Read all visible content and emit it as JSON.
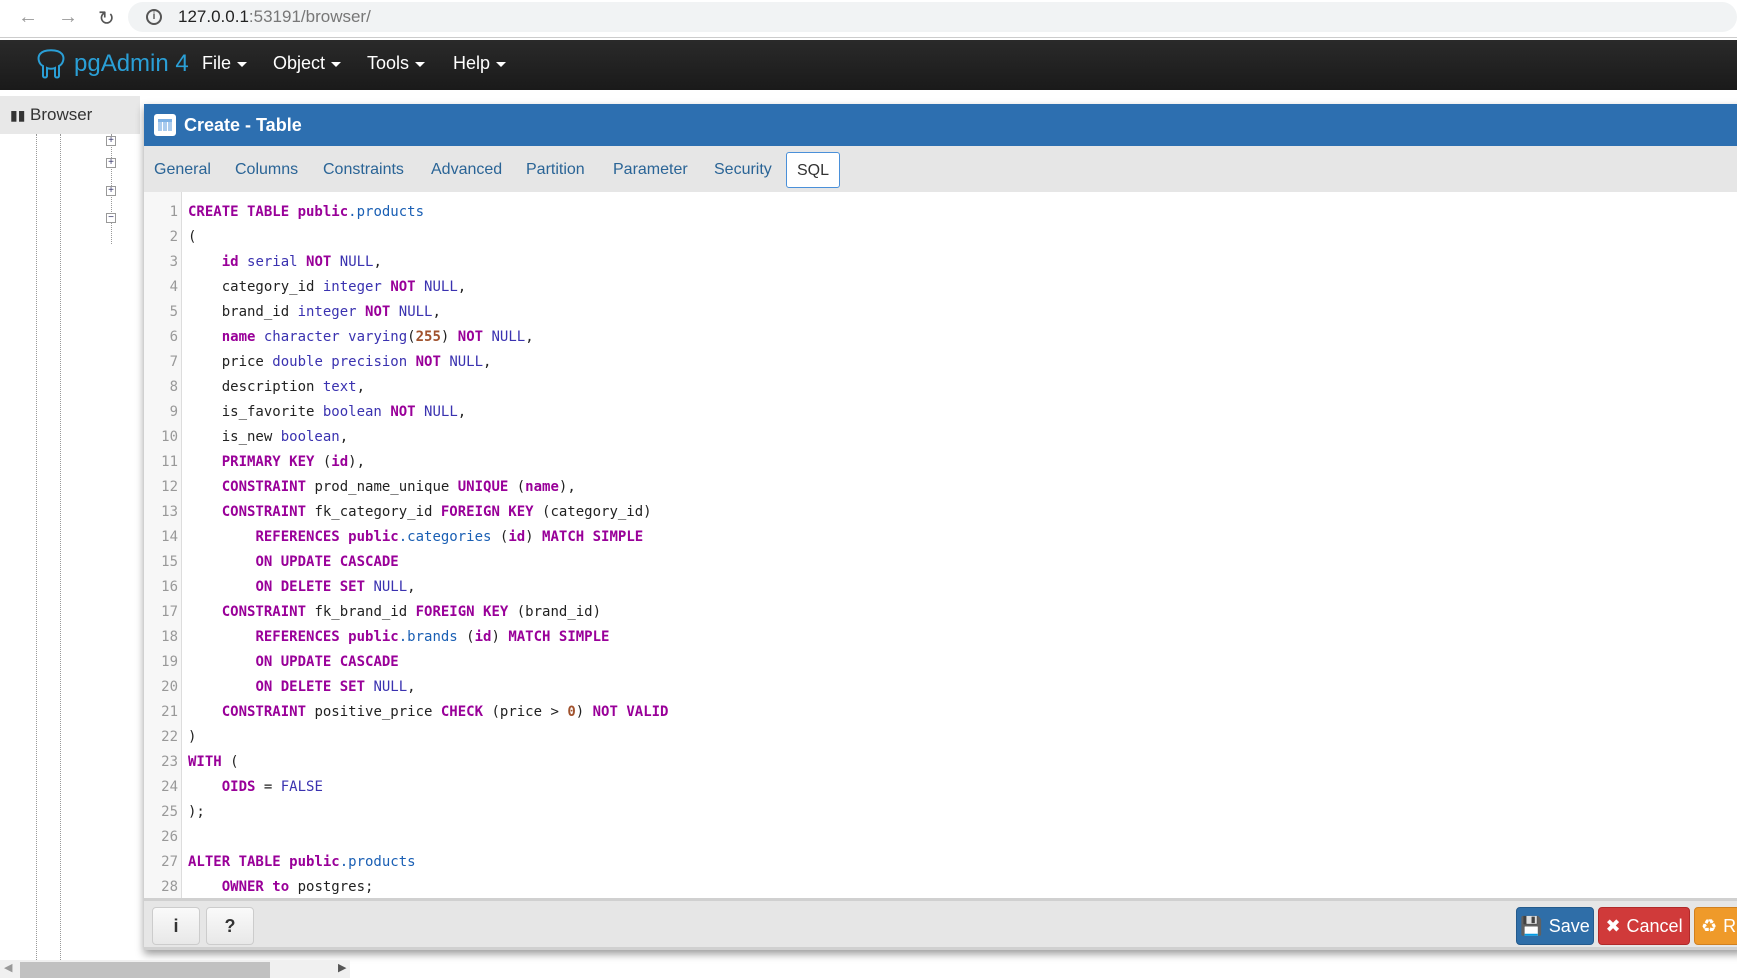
{
  "browser": {
    "url_host": "127.0.0.1",
    "url_rest": ":53191/browser/"
  },
  "app": {
    "brand": "pgAdmin 4",
    "menus": [
      "File",
      "Object",
      "Tools",
      "Help"
    ]
  },
  "panel": {
    "browser_tab": "Browser"
  },
  "dialog": {
    "title": "Create - Table",
    "tabs": [
      "General",
      "Columns",
      "Constraints",
      "Advanced",
      "Partition",
      "Parameter",
      "Security",
      "SQL"
    ],
    "active_tab": "SQL",
    "sql_lines": [
      [
        [
          "k",
          "CREATE TABLE public"
        ],
        [
          "v",
          ".products"
        ]
      ],
      [
        [
          "p",
          "("
        ]
      ],
      [
        [
          "p",
          "    "
        ],
        [
          "k",
          "id"
        ],
        [
          "p",
          " "
        ],
        [
          "t",
          "serial"
        ],
        [
          "p",
          " "
        ],
        [
          "k",
          "NOT"
        ],
        [
          "p",
          " "
        ],
        [
          "t",
          "NULL"
        ],
        [
          "p",
          ","
        ]
      ],
      [
        [
          "p",
          "    category_id "
        ],
        [
          "t",
          "integer"
        ],
        [
          "p",
          " "
        ],
        [
          "k",
          "NOT"
        ],
        [
          "p",
          " "
        ],
        [
          "t",
          "NULL"
        ],
        [
          "p",
          ","
        ]
      ],
      [
        [
          "p",
          "    brand_id "
        ],
        [
          "t",
          "integer"
        ],
        [
          "p",
          " "
        ],
        [
          "k",
          "NOT"
        ],
        [
          "p",
          " "
        ],
        [
          "t",
          "NULL"
        ],
        [
          "p",
          ","
        ]
      ],
      [
        [
          "p",
          "    "
        ],
        [
          "k",
          "name"
        ],
        [
          "p",
          " "
        ],
        [
          "t",
          "character varying"
        ],
        [
          "p",
          "("
        ],
        [
          "n",
          "255"
        ],
        [
          "p",
          ") "
        ],
        [
          "k",
          "NOT"
        ],
        [
          "p",
          " "
        ],
        [
          "t",
          "NULL"
        ],
        [
          "p",
          ","
        ]
      ],
      [
        [
          "p",
          "    price "
        ],
        [
          "t",
          "double precision"
        ],
        [
          "p",
          " "
        ],
        [
          "k",
          "NOT"
        ],
        [
          "p",
          " "
        ],
        [
          "t",
          "NULL"
        ],
        [
          "p",
          ","
        ]
      ],
      [
        [
          "p",
          "    description "
        ],
        [
          "t",
          "text"
        ],
        [
          "p",
          ","
        ]
      ],
      [
        [
          "p",
          "    is_favorite "
        ],
        [
          "t",
          "boolean"
        ],
        [
          "p",
          " "
        ],
        [
          "k",
          "NOT"
        ],
        [
          "p",
          " "
        ],
        [
          "t",
          "NULL"
        ],
        [
          "p",
          ","
        ]
      ],
      [
        [
          "p",
          "    is_new "
        ],
        [
          "t",
          "boolean"
        ],
        [
          "p",
          ","
        ]
      ],
      [
        [
          "p",
          "    "
        ],
        [
          "k",
          "PRIMARY KEY"
        ],
        [
          "p",
          " ("
        ],
        [
          "k",
          "id"
        ],
        [
          "p",
          "),"
        ]
      ],
      [
        [
          "p",
          "    "
        ],
        [
          "k",
          "CONSTRAINT"
        ],
        [
          "p",
          " prod_name_unique "
        ],
        [
          "k",
          "UNIQUE"
        ],
        [
          "p",
          " ("
        ],
        [
          "k",
          "name"
        ],
        [
          "p",
          "),"
        ]
      ],
      [
        [
          "p",
          "    "
        ],
        [
          "k",
          "CONSTRAINT"
        ],
        [
          "p",
          " fk_category_id "
        ],
        [
          "k",
          "FOREIGN KEY"
        ],
        [
          "p",
          " (category_id)"
        ]
      ],
      [
        [
          "p",
          "        "
        ],
        [
          "k",
          "REFERENCES public"
        ],
        [
          "v",
          ".categories"
        ],
        [
          "p",
          " ("
        ],
        [
          "k",
          "id"
        ],
        [
          "p",
          ") "
        ],
        [
          "k",
          "MATCH SIMPLE"
        ]
      ],
      [
        [
          "p",
          "        "
        ],
        [
          "k",
          "ON UPDATE CASCADE"
        ]
      ],
      [
        [
          "p",
          "        "
        ],
        [
          "k",
          "ON DELETE SET"
        ],
        [
          "p",
          " "
        ],
        [
          "t",
          "NULL"
        ],
        [
          "p",
          ","
        ]
      ],
      [
        [
          "p",
          "    "
        ],
        [
          "k",
          "CONSTRAINT"
        ],
        [
          "p",
          " fk_brand_id "
        ],
        [
          "k",
          "FOREIGN KEY"
        ],
        [
          "p",
          " (brand_id)"
        ]
      ],
      [
        [
          "p",
          "        "
        ],
        [
          "k",
          "REFERENCES public"
        ],
        [
          "v",
          ".brands"
        ],
        [
          "p",
          " ("
        ],
        [
          "k",
          "id"
        ],
        [
          "p",
          ") "
        ],
        [
          "k",
          "MATCH SIMPLE"
        ]
      ],
      [
        [
          "p",
          "        "
        ],
        [
          "k",
          "ON UPDATE CASCADE"
        ]
      ],
      [
        [
          "p",
          "        "
        ],
        [
          "k",
          "ON DELETE SET"
        ],
        [
          "p",
          " "
        ],
        [
          "t",
          "NULL"
        ],
        [
          "p",
          ","
        ]
      ],
      [
        [
          "p",
          "    "
        ],
        [
          "k",
          "CONSTRAINT"
        ],
        [
          "p",
          " positive_price "
        ],
        [
          "k",
          "CHECK"
        ],
        [
          "p",
          " (price > "
        ],
        [
          "n",
          "0"
        ],
        [
          "p",
          ") "
        ],
        [
          "k",
          "NOT VALID"
        ]
      ],
      [
        [
          "p",
          ")"
        ]
      ],
      [
        [
          "k",
          "WITH"
        ],
        [
          "p",
          " ("
        ]
      ],
      [
        [
          "p",
          "    "
        ],
        [
          "k",
          "OIDS"
        ],
        [
          "p",
          " = "
        ],
        [
          "t",
          "FALSE"
        ]
      ],
      [
        [
          "p",
          ");"
        ]
      ],
      [],
      [
        [
          "k",
          "ALTER TABLE public"
        ],
        [
          "v",
          ".products"
        ]
      ],
      [
        [
          "p",
          "    "
        ],
        [
          "k",
          "OWNER to"
        ],
        [
          "p",
          " postgres;"
        ]
      ]
    ],
    "footer": {
      "info_label": "i",
      "help_label": "?",
      "save_label": "Save",
      "cancel_label": "Cancel",
      "reset_label": "R"
    }
  },
  "colors": {
    "header": "#2d6fb0",
    "save": "#2f6ea8",
    "cancel": "#d03a3a",
    "reset": "#ef9a2a",
    "keyword": "#990099",
    "type": "#3a32b0",
    "variable": "#1a5fb4"
  }
}
